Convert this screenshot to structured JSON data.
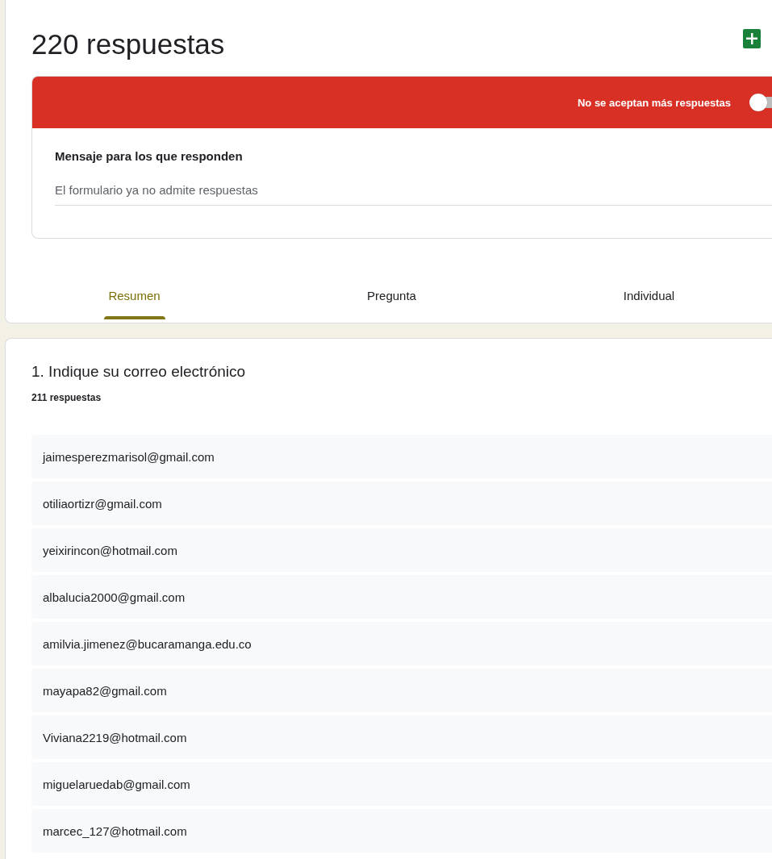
{
  "header": {
    "title": "220 respuestas"
  },
  "banner": {
    "label": "No se aceptan más respuestas",
    "accepting": false
  },
  "message": {
    "label": "Mensaje para los que responden",
    "value": "El formulario ya no admite respuestas"
  },
  "tabs": [
    {
      "label": "Resumen",
      "selected": true
    },
    {
      "label": "Pregunta",
      "selected": false
    },
    {
      "label": "Individual",
      "selected": false
    }
  ],
  "question": {
    "title": "1. Indique su correo electrónico",
    "count": "211 respuestas",
    "answers": [
      "jaimesperezmarisol@gmail.com",
      "otiliaortizr@gmail.com",
      "yeixirincon@hotmail.com",
      "albalucia2000@gmail.com",
      "amilvia.jimenez@bucaramanga.edu.co",
      "mayapa82@gmail.com",
      "Viviana2219@hotmail.com",
      "miguelaruedab@gmail.com",
      "marcec_127@hotmail.com"
    ]
  }
}
